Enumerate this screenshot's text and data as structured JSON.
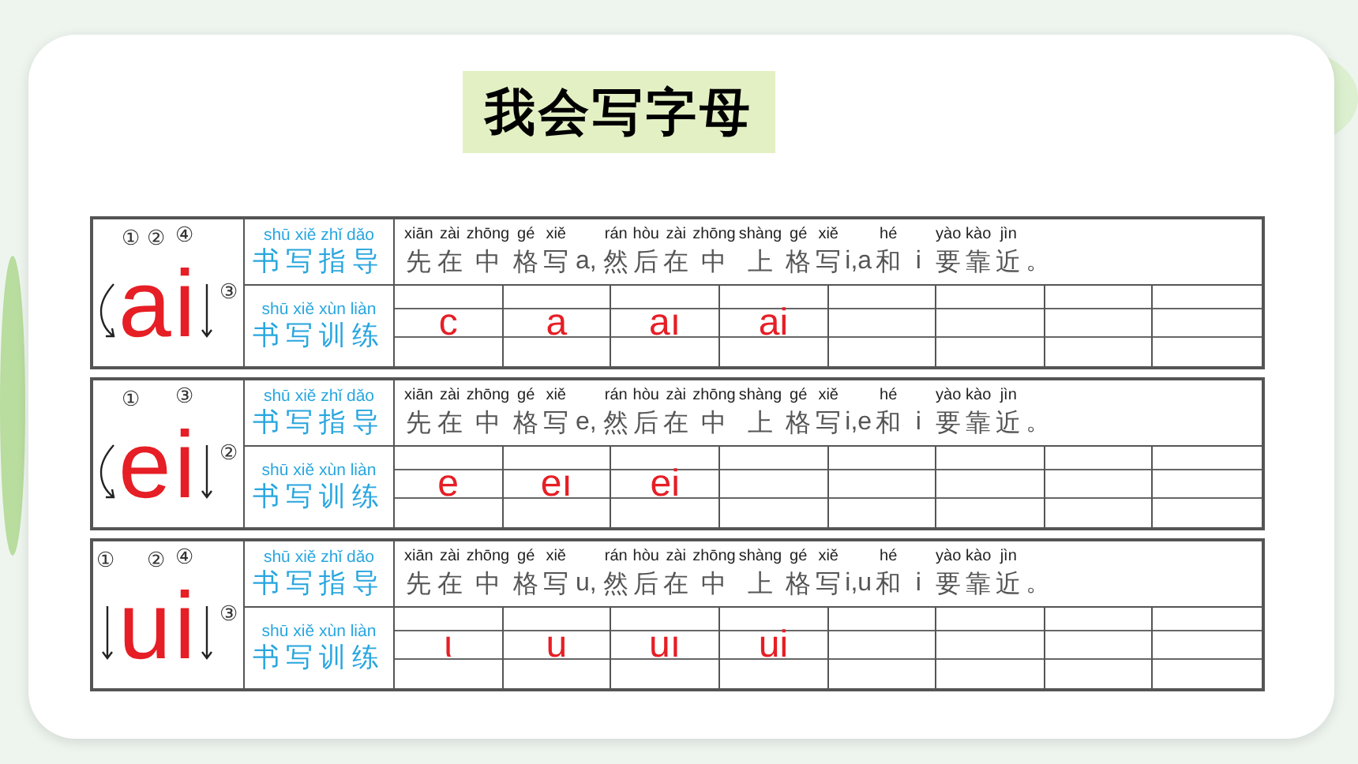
{
  "title": "我会写字母",
  "panels": [
    {
      "letters": [
        "a",
        "i"
      ],
      "stroke_marks": [
        "①",
        "②",
        "③",
        "④"
      ],
      "guide_label": {
        "pinyin": "shū xiě zhǐ dǎo",
        "text": "书写指导"
      },
      "guide": [
        {
          "pinyin": "xiān",
          "text": "先"
        },
        {
          "pinyin": "zài",
          "text": "在"
        },
        {
          "pinyin": "zhōng",
          "text": "中"
        },
        {
          "pinyin": "gé",
          "text": "格"
        },
        {
          "pinyin": "xiě",
          "text": "写"
        },
        {
          "text": "a,"
        },
        {
          "pinyin": "rán",
          "text": "然"
        },
        {
          "pinyin": "hòu",
          "text": "后"
        },
        {
          "pinyin": "zài",
          "text": "在"
        },
        {
          "pinyin": "zhōng",
          "text": "中"
        },
        {
          "pinyin": "shàng",
          "text": "上"
        },
        {
          "pinyin": "gé",
          "text": "格"
        },
        {
          "pinyin": "xiě",
          "text": "写"
        },
        {
          "text": "i,a"
        },
        {
          "pinyin": "hé",
          "text": "和"
        },
        {
          "text": "i"
        },
        {
          "pinyin": "yào",
          "text": "要"
        },
        {
          "pinyin": "kào",
          "text": "靠"
        },
        {
          "pinyin": "jìn",
          "text": "近"
        },
        {
          "text": "。"
        }
      ],
      "practice_label": {
        "pinyin": "shū xiě xùn liàn",
        "text": "书写训练"
      },
      "samples": [
        "c",
        "a",
        "aı",
        "ai"
      ]
    },
    {
      "letters": [
        "e",
        "i"
      ],
      "stroke_marks": [
        "①",
        "②",
        "③"
      ],
      "guide_label": {
        "pinyin": "shū xiě zhǐ dǎo",
        "text": "书写指导"
      },
      "guide": [
        {
          "pinyin": "xiān",
          "text": "先"
        },
        {
          "pinyin": "zài",
          "text": "在"
        },
        {
          "pinyin": "zhōng",
          "text": "中"
        },
        {
          "pinyin": "gé",
          "text": "格"
        },
        {
          "pinyin": "xiě",
          "text": "写"
        },
        {
          "text": "e,"
        },
        {
          "pinyin": "rán",
          "text": "然"
        },
        {
          "pinyin": "hòu",
          "text": "后"
        },
        {
          "pinyin": "zài",
          "text": "在"
        },
        {
          "pinyin": "zhōng",
          "text": "中"
        },
        {
          "pinyin": "shàng",
          "text": "上"
        },
        {
          "pinyin": "gé",
          "text": "格"
        },
        {
          "pinyin": "xiě",
          "text": "写"
        },
        {
          "text": "i,e"
        },
        {
          "pinyin": "hé",
          "text": "和"
        },
        {
          "text": "i"
        },
        {
          "pinyin": "yào",
          "text": "要"
        },
        {
          "pinyin": "kào",
          "text": "靠"
        },
        {
          "pinyin": "jìn",
          "text": "近"
        },
        {
          "text": "。"
        }
      ],
      "practice_label": {
        "pinyin": "shū xiě xùn liàn",
        "text": "书写训练"
      },
      "samples": [
        "e",
        "eı",
        "ei"
      ]
    },
    {
      "letters": [
        "u",
        "i"
      ],
      "stroke_marks": [
        "①",
        "②",
        "③",
        "④"
      ],
      "guide_label": {
        "pinyin": "shū xiě zhǐ dǎo",
        "text": "书写指导"
      },
      "guide": [
        {
          "pinyin": "xiān",
          "text": "先"
        },
        {
          "pinyin": "zài",
          "text": "在"
        },
        {
          "pinyin": "zhōng",
          "text": "中"
        },
        {
          "pinyin": "gé",
          "text": "格"
        },
        {
          "pinyin": "xiě",
          "text": "写"
        },
        {
          "text": "u,"
        },
        {
          "pinyin": "rán",
          "text": "然"
        },
        {
          "pinyin": "hòu",
          "text": "后"
        },
        {
          "pinyin": "zài",
          "text": "在"
        },
        {
          "pinyin": "zhōng",
          "text": "中"
        },
        {
          "pinyin": "shàng",
          "text": "上"
        },
        {
          "pinyin": "gé",
          "text": "格"
        },
        {
          "pinyin": "xiě",
          "text": "写"
        },
        {
          "text": "i,u"
        },
        {
          "pinyin": "hé",
          "text": "和"
        },
        {
          "text": "i"
        },
        {
          "pinyin": "yào",
          "text": "要"
        },
        {
          "pinyin": "kào",
          "text": "靠"
        },
        {
          "pinyin": "jìn",
          "text": "近"
        },
        {
          "text": "。"
        }
      ],
      "practice_label": {
        "pinyin": "shū xiě xùn liàn",
        "text": "书写训练"
      },
      "samples": [
        "ι",
        "u",
        "uı",
        "ui"
      ]
    }
  ]
}
